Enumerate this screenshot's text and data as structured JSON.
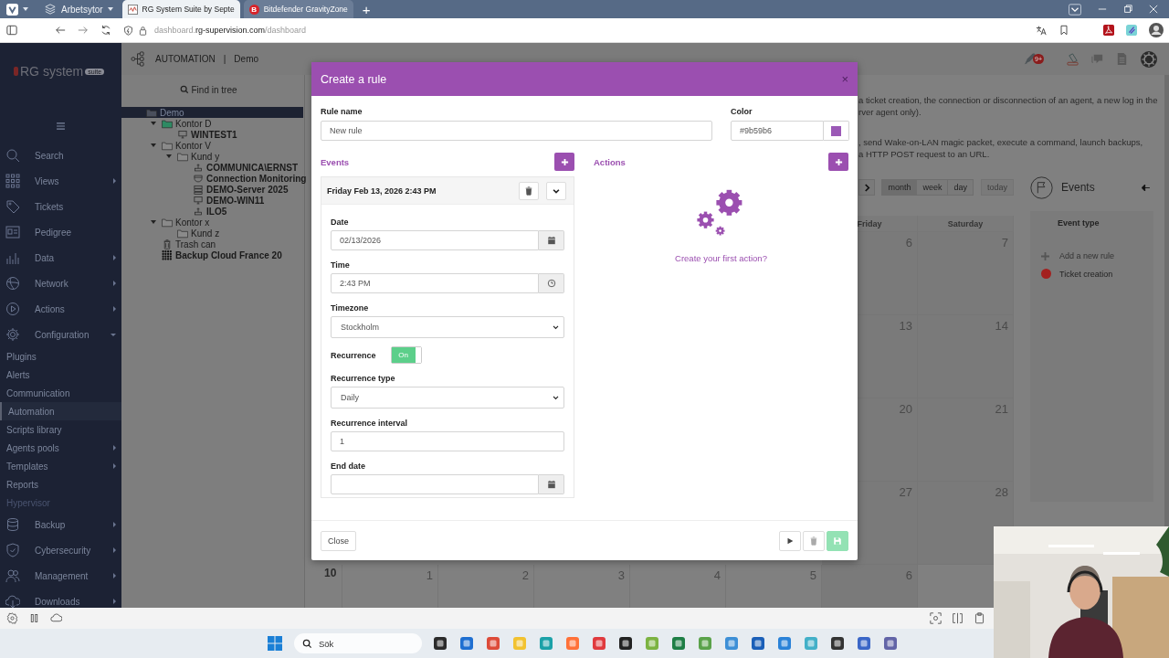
{
  "browser": {
    "workspace": "Arbetsytor",
    "tabs": [
      {
        "title": "RG System Suite by Septe",
        "selected": true
      },
      {
        "title": "Bitdefender GravityZone",
        "selected": false,
        "icon_letter": "B"
      }
    ],
    "new_tab": "+",
    "url": {
      "prefix": "dashboard.",
      "host": "rg-supervision.com",
      "path": "/dashboard"
    }
  },
  "sidebar": {
    "logo": "RG system",
    "logo_badge": "suite",
    "items": [
      {
        "label": "Search",
        "submenu": false
      },
      {
        "label": "Views",
        "submenu": true,
        "expanded": false
      },
      {
        "label": "Tickets",
        "submenu": false
      },
      {
        "label": "Pedigree",
        "submenu": false
      },
      {
        "label": "Data",
        "submenu": true,
        "expanded": false
      },
      {
        "label": "Network",
        "submenu": true,
        "expanded": false
      },
      {
        "label": "Actions",
        "submenu": true,
        "expanded": false
      },
      {
        "label": "Configuration",
        "submenu": true,
        "expanded": true,
        "children": [
          {
            "label": "Plugins",
            "submenu": false,
            "selected": false,
            "disabled": false
          },
          {
            "label": "Alerts",
            "submenu": false,
            "selected": false,
            "disabled": false
          },
          {
            "label": "Communication",
            "submenu": false,
            "selected": false,
            "disabled": false
          },
          {
            "label": "Automation",
            "submenu": false,
            "selected": true,
            "disabled": false
          },
          {
            "label": "Scripts library",
            "submenu": false,
            "selected": false,
            "disabled": false
          },
          {
            "label": "Agents pools",
            "submenu": true,
            "selected": false,
            "disabled": false
          },
          {
            "label": "Templates",
            "submenu": true,
            "selected": false,
            "disabled": false
          },
          {
            "label": "Reports",
            "submenu": false,
            "selected": false,
            "disabled": false
          },
          {
            "label": "Hypervisor",
            "submenu": false,
            "selected": false,
            "disabled": true
          }
        ]
      },
      {
        "label": "Backup",
        "submenu": true,
        "expanded": false
      },
      {
        "label": "Cybersecurity",
        "submenu": true,
        "expanded": false
      },
      {
        "label": "Management",
        "submenu": true,
        "expanded": false
      },
      {
        "label": "Downloads",
        "submenu": true,
        "expanded": false
      }
    ]
  },
  "header": {
    "section": "AUTOMATION",
    "separator": "|",
    "location": "Demo",
    "notification_badge": "9+"
  },
  "tree": {
    "search_placeholder": "Find in tree",
    "nodes": [
      {
        "label": "Demo",
        "kind": "folder",
        "color": "#4a4f5c",
        "selected": true,
        "children": [
          {
            "label": "Kontor D",
            "kind": "folder",
            "color": "#2e8a63",
            "expanded": true,
            "selected": false,
            "children": [
              {
                "label": "WINTEST1",
                "kind": "computer",
                "selected": false
              }
            ]
          },
          {
            "label": "Kontor V",
            "kind": "folder",
            "color": "#8a8a8a",
            "expanded": true,
            "selected": false,
            "children": [
              {
                "label": "Kund y",
                "kind": "folder",
                "color": "#8a8a8a",
                "expanded": true,
                "selected": false,
                "children": [
                  {
                    "label": "COMMUNICA\\ERNST",
                    "kind": "network",
                    "selected": false
                  },
                  {
                    "label": "Connection Monitoring",
                    "kind": "monitoring",
                    "selected": false
                  },
                  {
                    "label": "DEMO-Server 2025",
                    "kind": "server",
                    "selected": false
                  },
                  {
                    "label": "DEMO-WIN11",
                    "kind": "computer",
                    "selected": false
                  },
                  {
                    "label": "ILO5",
                    "kind": "network",
                    "selected": false
                  }
                ]
              }
            ]
          },
          {
            "label": "Kontor x",
            "kind": "folder",
            "color": "#8a8a8a",
            "expanded": true,
            "selected": false,
            "children": [
              {
                "label": "Kund z",
                "kind": "folder",
                "color": "#8a8a8a",
                "selected": false
              }
            ]
          },
          {
            "label": "Trash can",
            "kind": "trash",
            "selected": false
          },
          {
            "label": "Backup Cloud France 20",
            "kind": "backup",
            "selected": false
          }
        ]
      }
    ]
  },
  "description": [
    [
      "a ticket creation, the connection or disconnection of an agent, a new log in the",
      "rver agent only)."
    ],
    [
      ", send Wake-on-LAN magic packet, execute a command, launch backups,",
      "a HTTP POST request to an URL."
    ]
  ],
  "calendar": {
    "views": [
      {
        "label": "month",
        "selected": true
      },
      {
        "label": "week",
        "selected": false
      },
      {
        "label": "day",
        "selected": false
      }
    ],
    "today": {
      "label": "today",
      "disabled": true
    },
    "day_headers": [
      "Friday",
      "Saturday"
    ],
    "weeks": [
      {
        "days": [
          "6",
          "7"
        ]
      },
      {
        "days": [
          "13",
          "14"
        ]
      },
      {
        "days": [
          "20",
          "21"
        ]
      },
      {
        "days": [
          "27",
          "28"
        ]
      },
      {
        "week_number": "10",
        "days": [
          "1",
          "2",
          "3",
          "4",
          "5",
          "6"
        ]
      }
    ]
  },
  "events_panel": {
    "title": "Events",
    "column_header": "Event type",
    "add_rule": "Add a new rule",
    "types": [
      {
        "label": "Ticket creation",
        "color": "#a3201f"
      }
    ]
  },
  "modal": {
    "title": "Create a rule",
    "close": "×",
    "rule_name": {
      "label": "Rule name",
      "value": "New rule"
    },
    "color": {
      "label": "Color",
      "value": "#9b59b6",
      "color": "#9b59b6"
    },
    "events": {
      "label": "Events",
      "items": [
        {
          "title": "Friday Feb 13, 2026 2:43 PM",
          "expanded": true,
          "fields": [
            {
              "kind": "date",
              "label": "Date",
              "value": "02/13/2026"
            },
            {
              "kind": "time",
              "label": "Time",
              "value": "2:43 PM"
            },
            {
              "kind": "select",
              "label": "Timezone",
              "value": "Stockholm"
            },
            {
              "kind": "toggle",
              "label": "Recurrence",
              "on": true,
              "state_label": "On"
            },
            {
              "kind": "select",
              "label": "Recurrence type",
              "value": "Daily"
            },
            {
              "kind": "text",
              "label": "Recurrence interval",
              "value": "1"
            },
            {
              "kind": "date",
              "label": "End date"
            }
          ]
        }
      ]
    },
    "actions": {
      "label": "Actions",
      "empty_prompt": "Create your first action?"
    },
    "footer": {
      "close": "Close",
      "save_disabled": true
    }
  },
  "taskbar": {
    "search_placeholder": "Sök"
  },
  "webcam": {
    "kind": "picture"
  }
}
